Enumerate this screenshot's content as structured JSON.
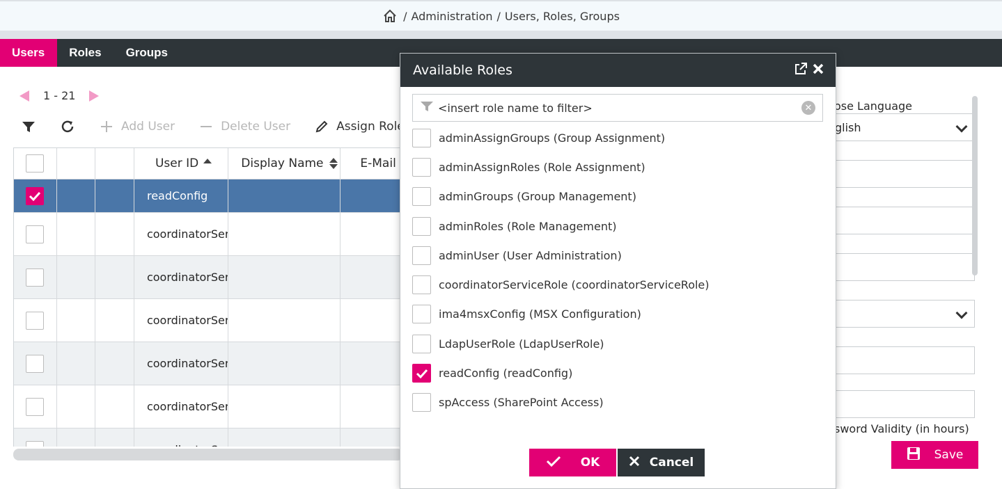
{
  "breadcrumb": {
    "sep": "/",
    "section": "Administration",
    "page": "Users, Roles, Groups"
  },
  "tabs": [
    {
      "label": "Users",
      "active": true
    },
    {
      "label": "Roles"
    },
    {
      "label": "Groups"
    }
  ],
  "pager": {
    "range": "1 - 21"
  },
  "toolbar": {
    "add_user": "Add User",
    "delete_user": "Delete User",
    "assign_roles": "Assign Roles"
  },
  "grid": {
    "columns": {
      "user_id": "User ID",
      "display_name": "Display Name",
      "email": "E-Mail"
    },
    "rows": [
      {
        "user_id": "readConfig",
        "checked": true,
        "selected": true
      },
      {
        "user_id": "coordinatorSer"
      },
      {
        "user_id": "coordinatorSer"
      },
      {
        "user_id": "coordinatorSer"
      },
      {
        "user_id": "coordinatorSer"
      },
      {
        "user_id": "coordinatorSer"
      },
      {
        "user_id": "coordinatorSer"
      }
    ]
  },
  "right_panel": {
    "language_label": "ose Language",
    "language_value": "glish",
    "password_validity_label": "sword Validity (in hours)",
    "save_label": "Save"
  },
  "dialog": {
    "title": "Available Roles",
    "filter_placeholder": "<insert role name to filter>",
    "roles": [
      {
        "label": "adminAssignGroups (Group Assignment)",
        "checked": false
      },
      {
        "label": "adminAssignRoles (Role Assignment)",
        "checked": false
      },
      {
        "label": "adminGroups (Group Management)",
        "checked": false
      },
      {
        "label": "adminRoles (Role Management)",
        "checked": false
      },
      {
        "label": "adminUser (User Administration)",
        "checked": false
      },
      {
        "label": "coordinatorServiceRole (coordinatorServiceRole)",
        "checked": false
      },
      {
        "label": "ima4msxConfig (MSX Configuration)",
        "checked": false
      },
      {
        "label": "LdapUserRole (LdapUserRole)",
        "checked": false
      },
      {
        "label": "readConfig (readConfig)",
        "checked": true
      },
      {
        "label": "spAccess (SharePoint Access)",
        "checked": false
      }
    ],
    "ok_label": "OK",
    "cancel_label": "Cancel"
  },
  "colors": {
    "accent": "#e20074",
    "dark": "#2e3539",
    "selected_row": "#4a76a8"
  }
}
